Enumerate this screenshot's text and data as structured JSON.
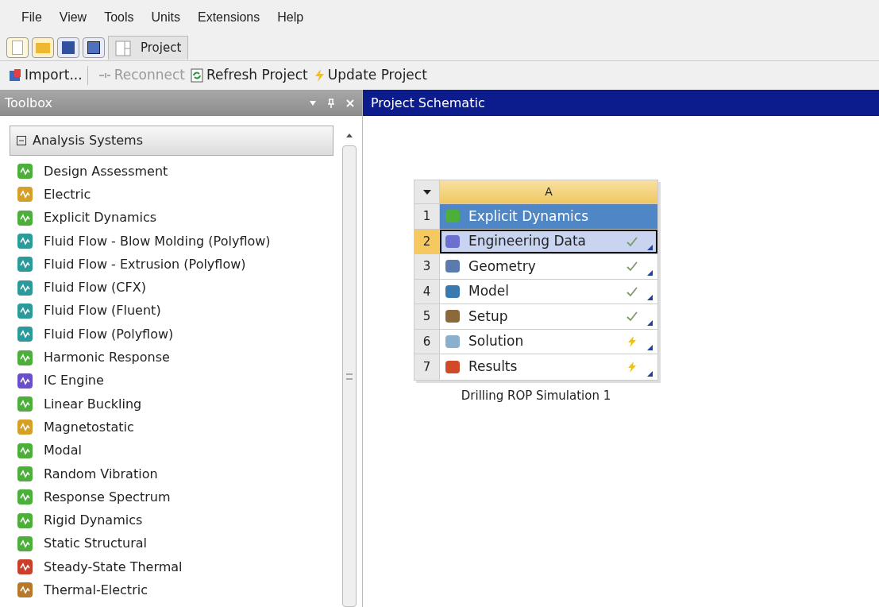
{
  "menu": [
    "File",
    "View",
    "Tools",
    "Units",
    "Extensions",
    "Help"
  ],
  "tab": {
    "label": "Project",
    "selected": true
  },
  "toolbar": [
    {
      "label": "Import...",
      "disabled": false,
      "kind": "import"
    },
    {
      "label": "Reconnect",
      "disabled": true,
      "kind": "reconnect"
    },
    {
      "label": "Refresh Project",
      "disabled": false,
      "kind": "refresh"
    },
    {
      "label": "Update Project",
      "disabled": false,
      "kind": "update"
    }
  ],
  "toolbox": {
    "title": "Toolbox",
    "group": {
      "label": "Analysis Systems",
      "expanded": true,
      "items": [
        {
          "label": "Design Assessment",
          "color": "#4caf3a"
        },
        {
          "label": "Electric",
          "color": "#d4a028"
        },
        {
          "label": "Explicit Dynamics",
          "color": "#4caf3a"
        },
        {
          "label": "Fluid Flow - Blow Molding (Polyflow)",
          "color": "#2a9a9a"
        },
        {
          "label": "Fluid Flow - Extrusion (Polyflow)",
          "color": "#2a9a9a"
        },
        {
          "label": "Fluid Flow (CFX)",
          "color": "#2a9a9a"
        },
        {
          "label": "Fluid Flow (Fluent)",
          "color": "#2a9a9a"
        },
        {
          "label": "Fluid Flow (Polyflow)",
          "color": "#2a9a9a"
        },
        {
          "label": "Harmonic Response",
          "color": "#4caf3a"
        },
        {
          "label": "IC Engine",
          "color": "#6a4fc8"
        },
        {
          "label": "Linear Buckling",
          "color": "#4caf3a"
        },
        {
          "label": "Magnetostatic",
          "color": "#d4a028"
        },
        {
          "label": "Modal",
          "color": "#4caf3a"
        },
        {
          "label": "Random Vibration",
          "color": "#4caf3a"
        },
        {
          "label": "Response Spectrum",
          "color": "#4caf3a"
        },
        {
          "label": "Rigid Dynamics",
          "color": "#4caf3a"
        },
        {
          "label": "Static Structural",
          "color": "#4caf3a"
        },
        {
          "label": "Steady-State Thermal",
          "color": "#c8402a"
        },
        {
          "label": "Thermal-Electric",
          "color": "#b8782a"
        }
      ]
    }
  },
  "schematic": {
    "title": "Project Schematic",
    "system": {
      "column": "A",
      "name": "Drilling ROP Simulation 1",
      "rows": [
        {
          "number": "1",
          "label": "Explicit Dynamics",
          "kind": "title",
          "up_to_date": false,
          "needs_update": false,
          "selected": false
        },
        {
          "number": "2",
          "label": "Engineering Data",
          "kind": "cell",
          "up_to_date": true,
          "needs_update": false,
          "selected": true
        },
        {
          "number": "3",
          "label": "Geometry",
          "kind": "cell",
          "up_to_date": true,
          "needs_update": false,
          "selected": false
        },
        {
          "number": "4",
          "label": "Model",
          "kind": "cell",
          "up_to_date": true,
          "needs_update": false,
          "selected": false
        },
        {
          "number": "5",
          "label": "Setup",
          "kind": "cell",
          "up_to_date": true,
          "needs_update": false,
          "selected": false
        },
        {
          "number": "6",
          "label": "Solution",
          "kind": "cell",
          "up_to_date": false,
          "needs_update": true,
          "selected": false
        },
        {
          "number": "7",
          "label": "Results",
          "kind": "cell",
          "up_to_date": false,
          "needs_update": true,
          "selected": false
        }
      ]
    }
  }
}
